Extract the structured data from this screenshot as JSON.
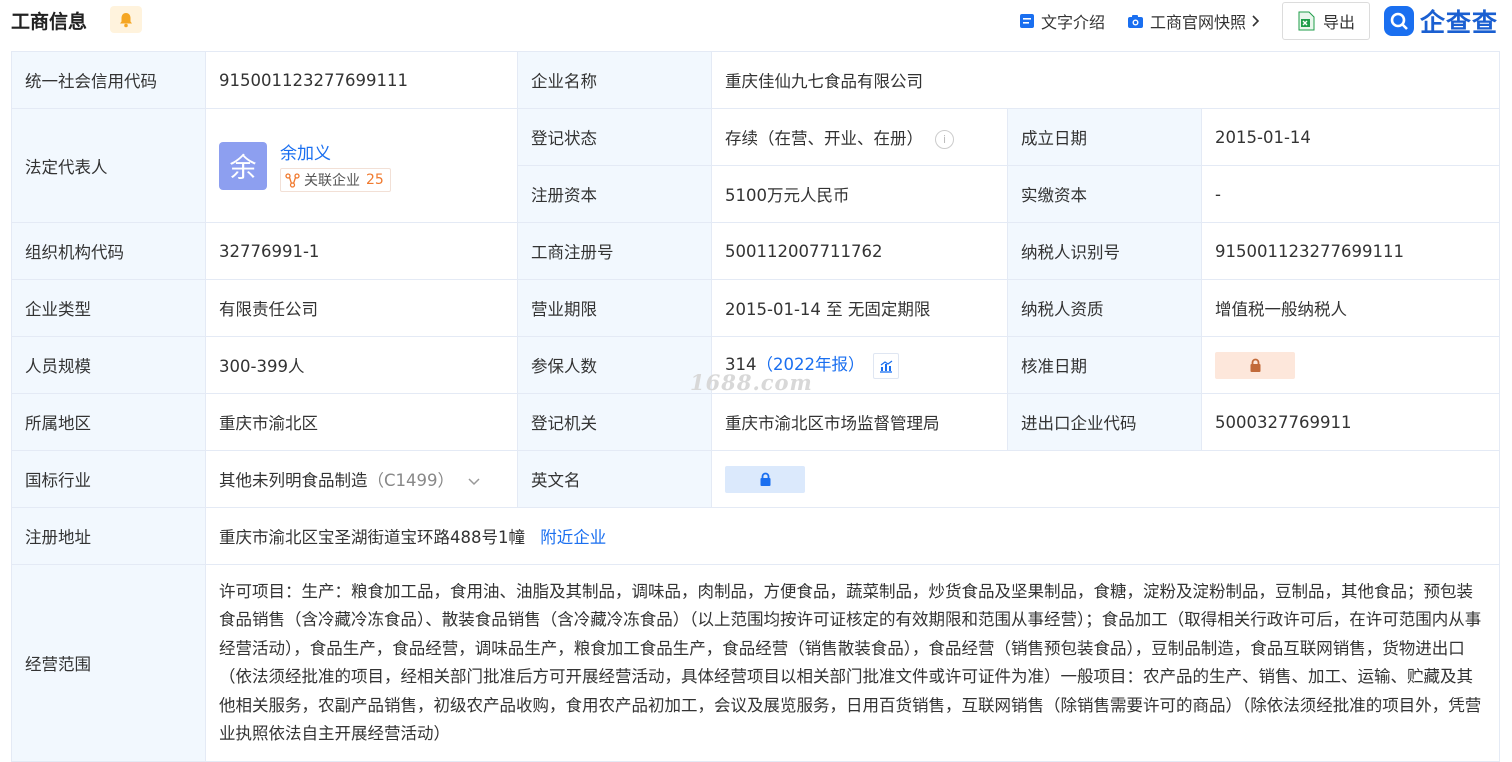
{
  "header": {
    "title": "工商信息",
    "tools": {
      "text_intro": "文字介绍",
      "snapshot": "工商官网快照",
      "export": "导出"
    },
    "brand": "企查查"
  },
  "rows": {
    "credit_code": {
      "label": "统一社会信用代码",
      "value": "915001123277699111"
    },
    "company_name": {
      "label": "企业名称",
      "value": "重庆佳仙九七食品有限公司"
    },
    "legal_rep": {
      "label": "法定代表人",
      "avatar_char": "余",
      "name": "余加义",
      "related_label": "关联企业",
      "related_count": "25"
    },
    "reg_status": {
      "label": "登记状态",
      "value": "存续（在营、开业、在册）"
    },
    "found_date": {
      "label": "成立日期",
      "value": "2015-01-14"
    },
    "reg_capital": {
      "label": "注册资本",
      "value": "5100万元人民币"
    },
    "paid_capital": {
      "label": "实缴资本",
      "value": "-"
    },
    "org_code": {
      "label": "组织机构代码",
      "value": "32776991-1"
    },
    "biz_reg_no": {
      "label": "工商注册号",
      "value": "500112007711762"
    },
    "taxpayer_id": {
      "label": "纳税人识别号",
      "value": "915001123277699111"
    },
    "company_type": {
      "label": "企业类型",
      "value": "有限责任公司"
    },
    "biz_term": {
      "label": "营业期限",
      "value": "2015-01-14 至 无固定期限"
    },
    "taxpayer_qual": {
      "label": "纳税人资质",
      "value": "增值税一般纳税人"
    },
    "staff_size": {
      "label": "人员规模",
      "value": "300-399人"
    },
    "insured": {
      "label": "参保人数",
      "value": "314",
      "year_note": "（2022年报）"
    },
    "approve_date": {
      "label": "核准日期"
    },
    "region": {
      "label": "所属地区",
      "value": "重庆市渝北区"
    },
    "reg_authority": {
      "label": "登记机关",
      "value": "重庆市渝北区市场监督管理局"
    },
    "import_export": {
      "label": "进出口企业代码",
      "value": "5000327769911"
    },
    "industry": {
      "label": "国标行业",
      "value": "其他未列明食品制造",
      "code": "（C1499）"
    },
    "english_name": {
      "label": "英文名"
    },
    "address": {
      "label": "注册地址",
      "value": "重庆市渝北区宝圣湖街道宝环路488号1幢",
      "nearby": "附近企业"
    },
    "scope": {
      "label": "经营范围",
      "value": "许可项目：生产：粮食加工品，食用油、油脂及其制品，调味品，肉制品，方便食品，蔬菜制品，炒货食品及坚果制品，食糖，淀粉及淀粉制品，豆制品，其他食品；预包装食品销售（含冷藏冷冻食品）、散装食品销售（含冷藏冷冻食品）（以上范围均按许可证核定的有效期限和范围从事经营）；食品加工（取得相关行政许可后，在许可范围内从事经营活动），食品生产，食品经营，调味品生产，粮食加工食品生产，食品经营（销售散装食品），食品经营（销售预包装食品），豆制品制造，食品互联网销售，货物进出口（依法须经批准的项目，经相关部门批准后方可开展经营活动，具体经营项目以相关部门批准文件或许可证件为准）一般项目：农产品的生产、销售、加工、运输、贮藏及其他相关服务，农副产品销售，初级农产品收购，食用农产品初加工，会议及展览服务，日用百货销售，互联网销售（除销售需要许可的商品）（除依法须经批准的项目外，凭营业执照依法自主开展经营活动）"
    }
  },
  "watermark": "1688.com",
  "colors": {
    "accent": "#1a6ff0",
    "label_bg": "#f2f8fe",
    "tag_count": "#f07a2f"
  }
}
